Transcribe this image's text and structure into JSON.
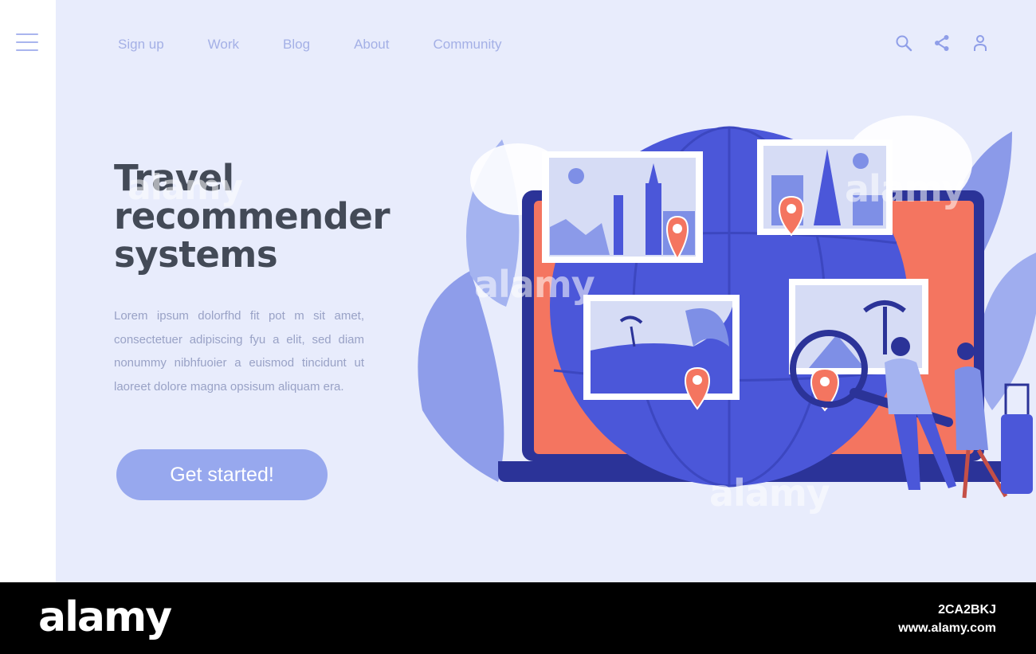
{
  "nav": {
    "items": [
      {
        "label": "Sign up"
      },
      {
        "label": "Work"
      },
      {
        "label": "Blog"
      },
      {
        "label": "About"
      },
      {
        "label": "Community"
      }
    ],
    "icons": [
      "search-icon",
      "share-icon",
      "user-icon"
    ]
  },
  "hero": {
    "title_lines": [
      "Travel",
      "recommender",
      "systems"
    ],
    "body": "Lorem ipsum dolorfhd fit pot m sit amet, consectetuer adipiscing fyu a elit, sed diam nonummy nibhfuoier a euismod tincidunt ut laoreet dolore magna opsisum aliquam era.",
    "cta_label": "Get started!"
  },
  "watermark": {
    "text": "alamy"
  },
  "footer": {
    "logo": "alamy",
    "image_id": "2CA2BKJ",
    "url": "www.alamy.com"
  },
  "colors": {
    "background": "#e8ecfc",
    "accent": "#97a8ee",
    "title": "#434a57",
    "nav_text": "#a4b0e6",
    "coral": "#f47560",
    "globe": "#4b57d9",
    "navy": "#2b3398"
  }
}
